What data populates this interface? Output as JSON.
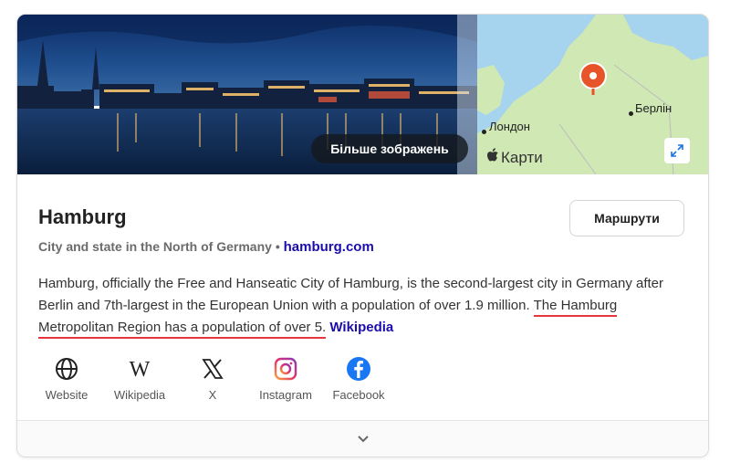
{
  "hero": {
    "more_images_label": "Більше зображень",
    "map": {
      "cities": [
        "Лондон",
        "Берлін"
      ],
      "brand_label": "Карти",
      "pin_color": "#e8542a"
    }
  },
  "place": {
    "name": "Hamburg",
    "subtitle": "City and state in the North of Germany",
    "separator": "•",
    "website": "hamburg.com",
    "directions_label": "Маршрути"
  },
  "description": {
    "part1": "Hamburg, officially the Free and Hanseatic City of Hamburg, is the second-largest city in Germany after Berlin and 7th-largest in the European Union with a population of over 1.9 million. ",
    "part2_underlined": "The Hamburg Metropolitan Region has a population of over 5.",
    "source_link": "Wikipedia"
  },
  "links": [
    {
      "label": "Website",
      "icon": "globe-icon"
    },
    {
      "label": "Wikipedia",
      "icon": "wikipedia-icon"
    },
    {
      "label": "X",
      "icon": "x-icon"
    },
    {
      "label": "Instagram",
      "icon": "instagram-icon"
    },
    {
      "label": "Facebook",
      "icon": "facebook-icon"
    }
  ],
  "colors": {
    "link": "#1a0dab",
    "underline": "#e8353b",
    "facebook": "#1877f2"
  }
}
